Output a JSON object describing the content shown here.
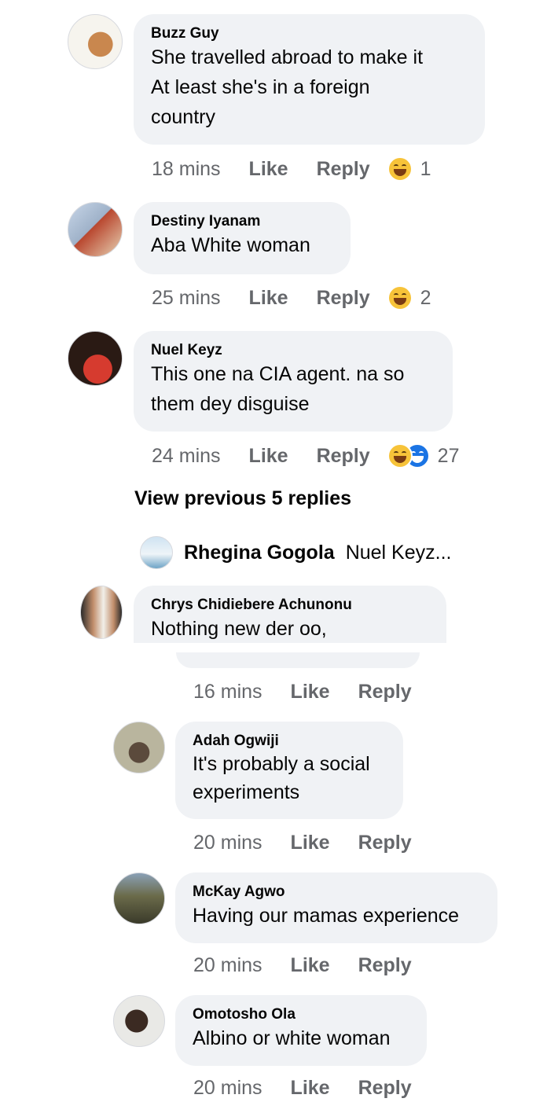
{
  "comments": [
    {
      "name": "Buzz Guy",
      "lines": [
        "She travelled abroad to make it",
        "At least she's in a foreign",
        "country"
      ],
      "time": "18 mins",
      "like": "Like",
      "reply": "Reply",
      "reaction_count": "1"
    },
    {
      "name": "Destiny Iyanam",
      "lines": [
        "Aba White woman"
      ],
      "time": "25 mins",
      "like": "Like",
      "reply": "Reply",
      "reaction_count": "2"
    },
    {
      "name": "Nuel Keyz",
      "lines": [
        "This one na CIA agent. na so",
        "them dey disguise"
      ],
      "time": "24 mins",
      "like": "Like",
      "reply": "Reply",
      "reaction_count": "27"
    }
  ],
  "view_previous": "View previous 5 replies",
  "reply_preview": {
    "name": "Rhegina Gogola",
    "text": "Nuel Keyz..."
  },
  "chrys": {
    "name": "Chrys Chidiebere Achunonu",
    "line": "Nothing new der oo,",
    "time": "16 mins",
    "like": "Like",
    "reply": "Reply"
  },
  "replies": [
    {
      "name": "Adah Ogwiji",
      "lines": [
        "It's probably a social",
        "experiments"
      ],
      "time": "20 mins",
      "like": "Like",
      "reply": "Reply"
    },
    {
      "name": "McKay Agwo",
      "lines": [
        "Having our mamas experience"
      ],
      "time": "20 mins",
      "like": "Like",
      "reply": "Reply"
    },
    {
      "name": "Omotosho Ola",
      "lines": [
        "Albino or white woman"
      ],
      "time": "20 mins",
      "like": "Like",
      "reply": "Reply"
    }
  ],
  "colors": {
    "bubble": "#f0f2f5",
    "meta": "#65676b",
    "reaction_yellow": "#f7c339",
    "reaction_blue": "#1b74e4"
  }
}
